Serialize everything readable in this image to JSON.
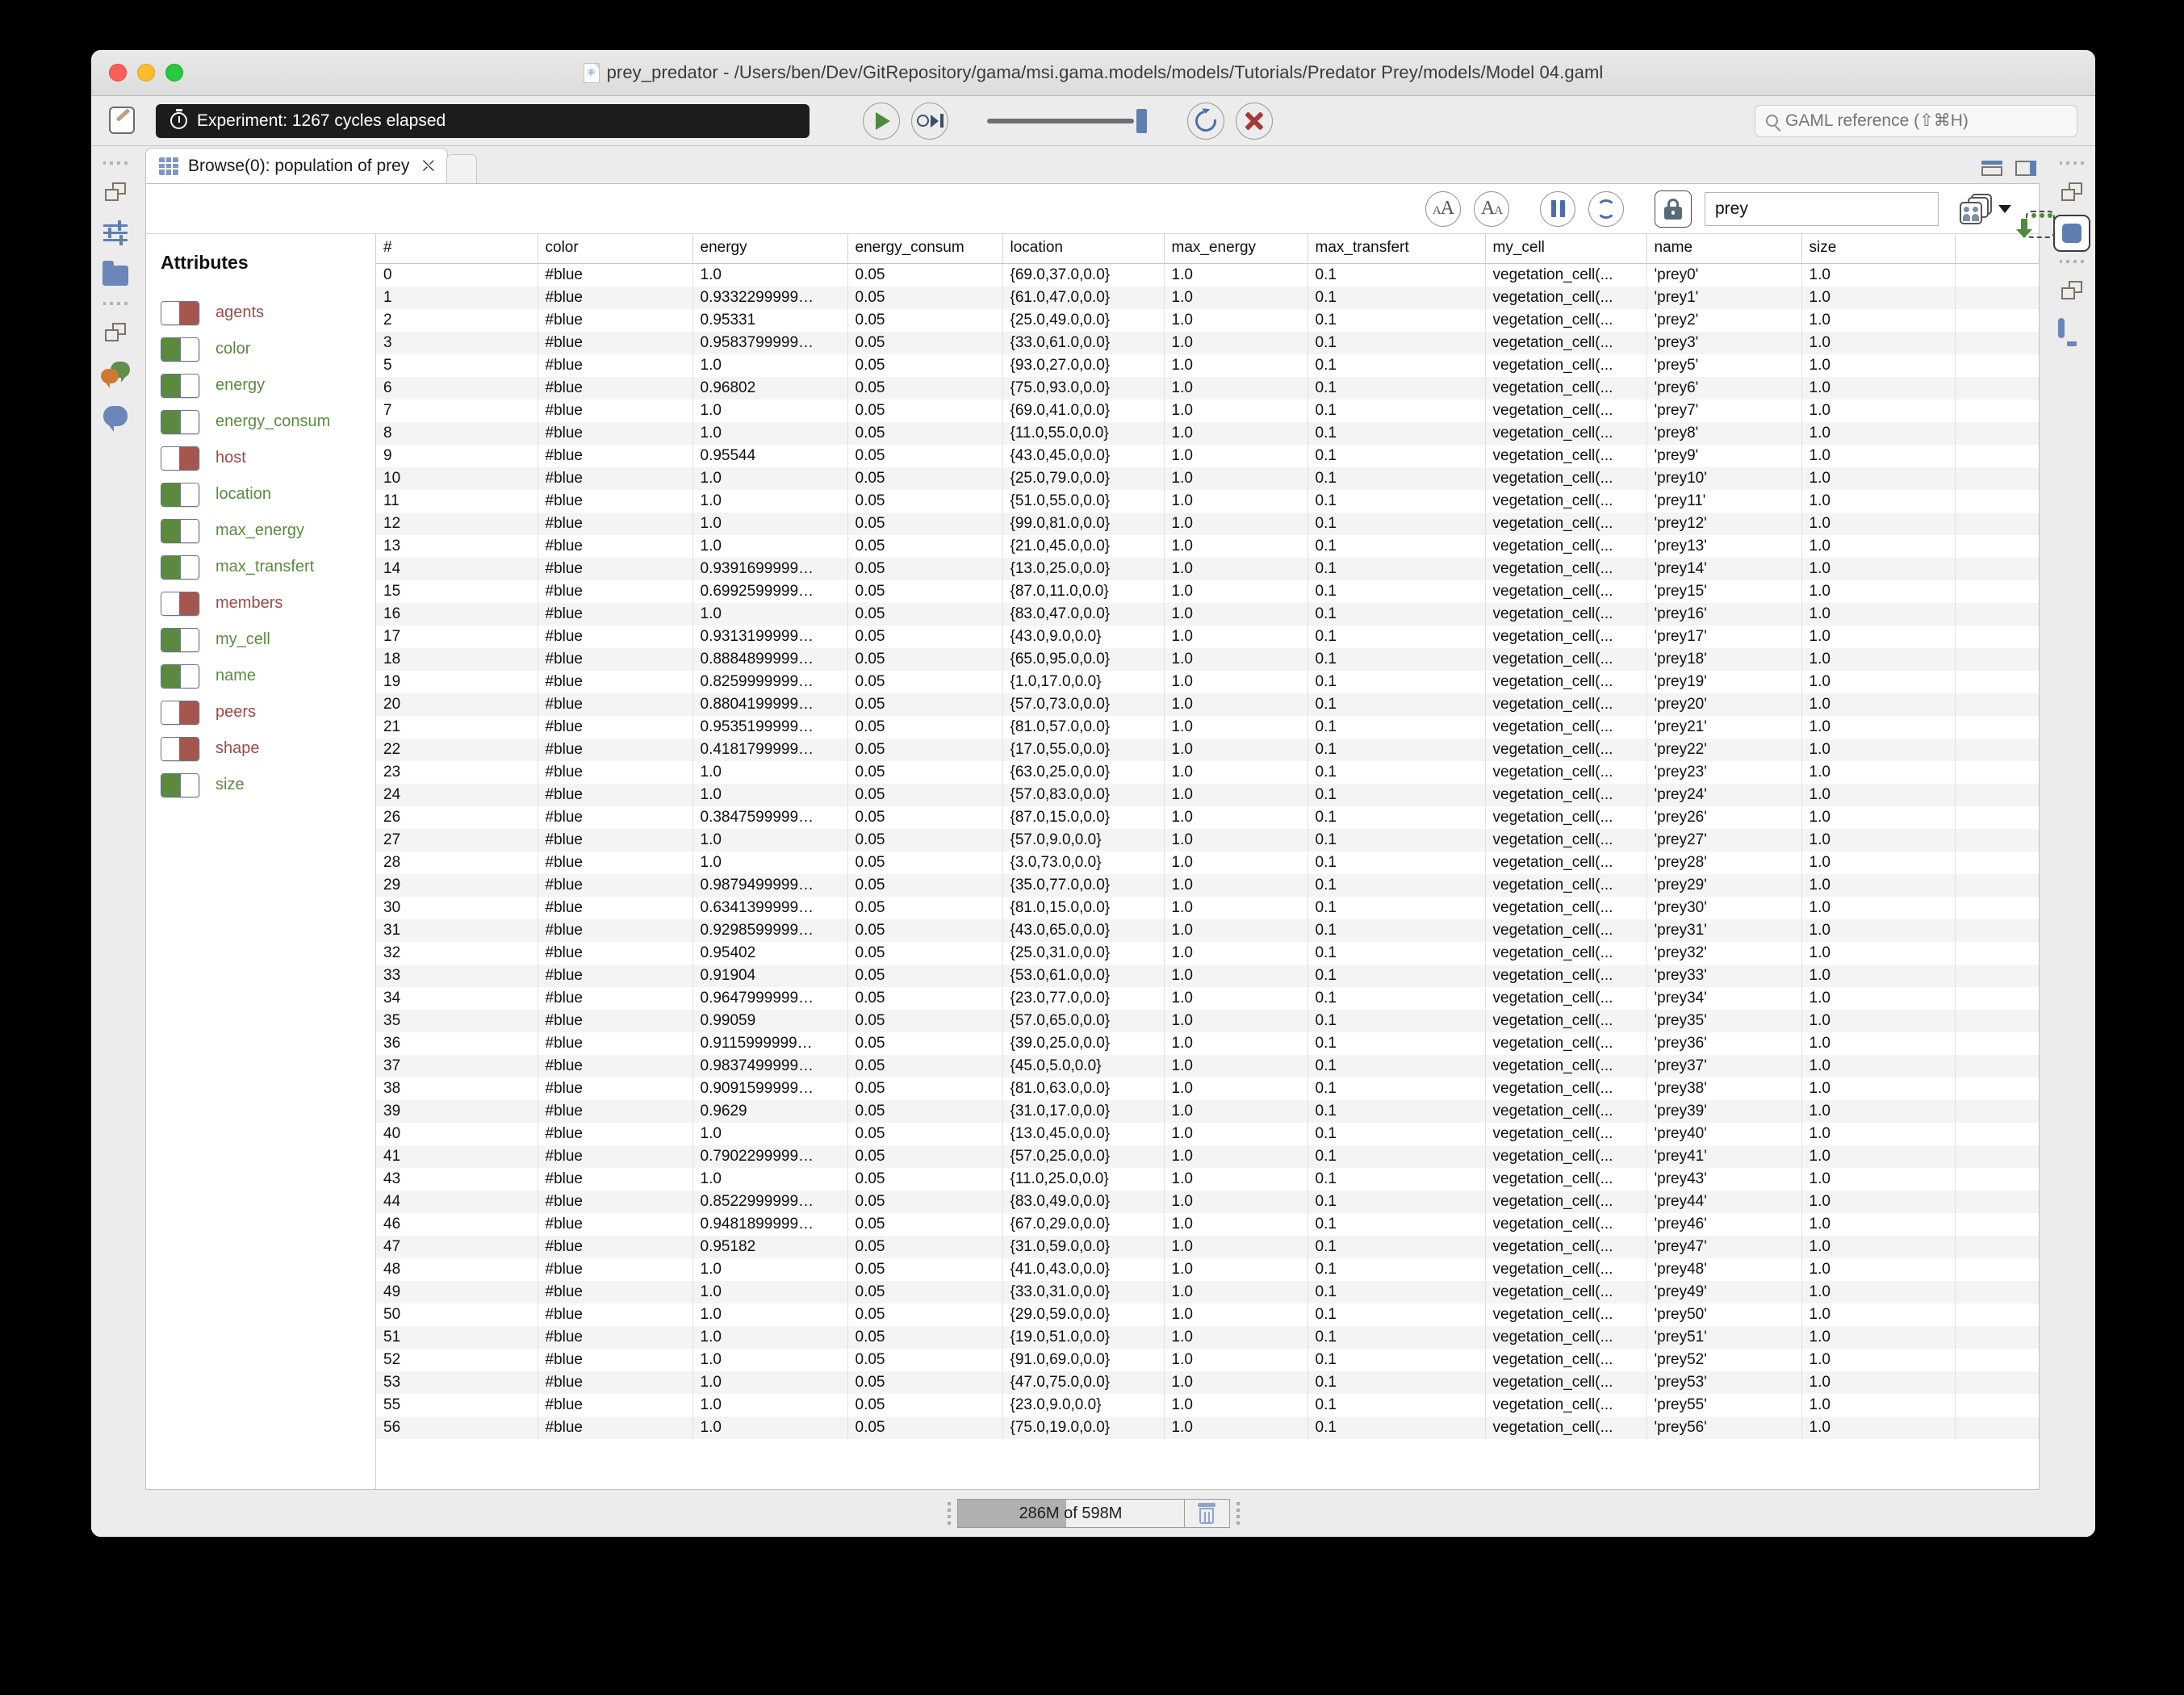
{
  "window": {
    "title": "prey_predator - /Users/ben/Dev/GitRepository/gama/msi.gama.models/models/Tutorials/Predator Prey/models/Model 04.gaml"
  },
  "toolbar": {
    "experiment_status": "Experiment: 1267 cycles elapsed",
    "play_label": "Run",
    "step_label": "Step",
    "reload_label": "Reload",
    "stop_label": "Close",
    "gaml_search_placeholder": "GAML reference (⇧⌘H)"
  },
  "tab": {
    "label": "Browse(0): population of prey"
  },
  "panel_toolbar": {
    "font_increase_label": "AA",
    "font_decrease_label": "AA",
    "pause_label": "Pause",
    "refresh_label": "Refresh",
    "lock_label": "Lock",
    "filter_value": "prey",
    "filter_placeholder": "",
    "agents_label": "Agents",
    "export_label": "Export"
  },
  "attributes": {
    "title": "Attributes",
    "items": [
      {
        "label": "agents",
        "enabled": false
      },
      {
        "label": "color",
        "enabled": true
      },
      {
        "label": "energy",
        "enabled": true
      },
      {
        "label": "energy_consum",
        "enabled": true
      },
      {
        "label": "host",
        "enabled": false
      },
      {
        "label": "location",
        "enabled": true
      },
      {
        "label": "max_energy",
        "enabled": true
      },
      {
        "label": "max_transfert",
        "enabled": true
      },
      {
        "label": "members",
        "enabled": false
      },
      {
        "label": "my_cell",
        "enabled": true
      },
      {
        "label": "name",
        "enabled": true
      },
      {
        "label": "peers",
        "enabled": false
      },
      {
        "label": "shape",
        "enabled": false
      },
      {
        "label": "size",
        "enabled": true
      }
    ]
  },
  "table": {
    "columns": [
      "#",
      "color",
      "energy",
      "energy_consum",
      "location",
      "max_energy",
      "max_transfert",
      "my_cell",
      "name",
      "size"
    ],
    "rows": [
      [
        "0",
        "#blue",
        "1.0",
        "0.05",
        "{69.0,37.0,0.0}",
        "1.0",
        "0.1",
        "vegetation_cell(...",
        "'prey0'",
        "1.0"
      ],
      [
        "1",
        "#blue",
        "0.9332299999…",
        "0.05",
        "{61.0,47.0,0.0}",
        "1.0",
        "0.1",
        "vegetation_cell(...",
        "'prey1'",
        "1.0"
      ],
      [
        "2",
        "#blue",
        "0.95331",
        "0.05",
        "{25.0,49.0,0.0}",
        "1.0",
        "0.1",
        "vegetation_cell(...",
        "'prey2'",
        "1.0"
      ],
      [
        "3",
        "#blue",
        "0.9583799999…",
        "0.05",
        "{33.0,61.0,0.0}",
        "1.0",
        "0.1",
        "vegetation_cell(...",
        "'prey3'",
        "1.0"
      ],
      [
        "5",
        "#blue",
        "1.0",
        "0.05",
        "{93.0,27.0,0.0}",
        "1.0",
        "0.1",
        "vegetation_cell(...",
        "'prey5'",
        "1.0"
      ],
      [
        "6",
        "#blue",
        "0.96802",
        "0.05",
        "{75.0,93.0,0.0}",
        "1.0",
        "0.1",
        "vegetation_cell(...",
        "'prey6'",
        "1.0"
      ],
      [
        "7",
        "#blue",
        "1.0",
        "0.05",
        "{69.0,41.0,0.0}",
        "1.0",
        "0.1",
        "vegetation_cell(...",
        "'prey7'",
        "1.0"
      ],
      [
        "8",
        "#blue",
        "1.0",
        "0.05",
        "{11.0,55.0,0.0}",
        "1.0",
        "0.1",
        "vegetation_cell(...",
        "'prey8'",
        "1.0"
      ],
      [
        "9",
        "#blue",
        "0.95544",
        "0.05",
        "{43.0,45.0,0.0}",
        "1.0",
        "0.1",
        "vegetation_cell(...",
        "'prey9'",
        "1.0"
      ],
      [
        "10",
        "#blue",
        "1.0",
        "0.05",
        "{25.0,79.0,0.0}",
        "1.0",
        "0.1",
        "vegetation_cell(...",
        "'prey10'",
        "1.0"
      ],
      [
        "11",
        "#blue",
        "1.0",
        "0.05",
        "{51.0,55.0,0.0}",
        "1.0",
        "0.1",
        "vegetation_cell(...",
        "'prey11'",
        "1.0"
      ],
      [
        "12",
        "#blue",
        "1.0",
        "0.05",
        "{99.0,81.0,0.0}",
        "1.0",
        "0.1",
        "vegetation_cell(...",
        "'prey12'",
        "1.0"
      ],
      [
        "13",
        "#blue",
        "1.0",
        "0.05",
        "{21.0,45.0,0.0}",
        "1.0",
        "0.1",
        "vegetation_cell(...",
        "'prey13'",
        "1.0"
      ],
      [
        "14",
        "#blue",
        "0.9391699999…",
        "0.05",
        "{13.0,25.0,0.0}",
        "1.0",
        "0.1",
        "vegetation_cell(...",
        "'prey14'",
        "1.0"
      ],
      [
        "15",
        "#blue",
        "0.6992599999…",
        "0.05",
        "{87.0,11.0,0.0}",
        "1.0",
        "0.1",
        "vegetation_cell(...",
        "'prey15'",
        "1.0"
      ],
      [
        "16",
        "#blue",
        "1.0",
        "0.05",
        "{83.0,47.0,0.0}",
        "1.0",
        "0.1",
        "vegetation_cell(...",
        "'prey16'",
        "1.0"
      ],
      [
        "17",
        "#blue",
        "0.9313199999…",
        "0.05",
        "{43.0,9.0,0.0}",
        "1.0",
        "0.1",
        "vegetation_cell(...",
        "'prey17'",
        "1.0"
      ],
      [
        "18",
        "#blue",
        "0.8884899999…",
        "0.05",
        "{65.0,95.0,0.0}",
        "1.0",
        "0.1",
        "vegetation_cell(...",
        "'prey18'",
        "1.0"
      ],
      [
        "19",
        "#blue",
        "0.8259999999…",
        "0.05",
        "{1.0,17.0,0.0}",
        "1.0",
        "0.1",
        "vegetation_cell(...",
        "'prey19'",
        "1.0"
      ],
      [
        "20",
        "#blue",
        "0.8804199999…",
        "0.05",
        "{57.0,73.0,0.0}",
        "1.0",
        "0.1",
        "vegetation_cell(...",
        "'prey20'",
        "1.0"
      ],
      [
        "21",
        "#blue",
        "0.9535199999…",
        "0.05",
        "{81.0,57.0,0.0}",
        "1.0",
        "0.1",
        "vegetation_cell(...",
        "'prey21'",
        "1.0"
      ],
      [
        "22",
        "#blue",
        "0.4181799999…",
        "0.05",
        "{17.0,55.0,0.0}",
        "1.0",
        "0.1",
        "vegetation_cell(...",
        "'prey22'",
        "1.0"
      ],
      [
        "23",
        "#blue",
        "1.0",
        "0.05",
        "{63.0,25.0,0.0}",
        "1.0",
        "0.1",
        "vegetation_cell(...",
        "'prey23'",
        "1.0"
      ],
      [
        "24",
        "#blue",
        "1.0",
        "0.05",
        "{57.0,83.0,0.0}",
        "1.0",
        "0.1",
        "vegetation_cell(...",
        "'prey24'",
        "1.0"
      ],
      [
        "26",
        "#blue",
        "0.3847599999…",
        "0.05",
        "{87.0,15.0,0.0}",
        "1.0",
        "0.1",
        "vegetation_cell(...",
        "'prey26'",
        "1.0"
      ],
      [
        "27",
        "#blue",
        "1.0",
        "0.05",
        "{57.0,9.0,0.0}",
        "1.0",
        "0.1",
        "vegetation_cell(...",
        "'prey27'",
        "1.0"
      ],
      [
        "28",
        "#blue",
        "1.0",
        "0.05",
        "{3.0,73.0,0.0}",
        "1.0",
        "0.1",
        "vegetation_cell(...",
        "'prey28'",
        "1.0"
      ],
      [
        "29",
        "#blue",
        "0.9879499999…",
        "0.05",
        "{35.0,77.0,0.0}",
        "1.0",
        "0.1",
        "vegetation_cell(...",
        "'prey29'",
        "1.0"
      ],
      [
        "30",
        "#blue",
        "0.6341399999…",
        "0.05",
        "{81.0,15.0,0.0}",
        "1.0",
        "0.1",
        "vegetation_cell(...",
        "'prey30'",
        "1.0"
      ],
      [
        "31",
        "#blue",
        "0.9298599999…",
        "0.05",
        "{43.0,65.0,0.0}",
        "1.0",
        "0.1",
        "vegetation_cell(...",
        "'prey31'",
        "1.0"
      ],
      [
        "32",
        "#blue",
        "0.95402",
        "0.05",
        "{25.0,31.0,0.0}",
        "1.0",
        "0.1",
        "vegetation_cell(...",
        "'prey32'",
        "1.0"
      ],
      [
        "33",
        "#blue",
        "0.91904",
        "0.05",
        "{53.0,61.0,0.0}",
        "1.0",
        "0.1",
        "vegetation_cell(...",
        "'prey33'",
        "1.0"
      ],
      [
        "34",
        "#blue",
        "0.9647999999…",
        "0.05",
        "{23.0,77.0,0.0}",
        "1.0",
        "0.1",
        "vegetation_cell(...",
        "'prey34'",
        "1.0"
      ],
      [
        "35",
        "#blue",
        "0.99059",
        "0.05",
        "{57.0,65.0,0.0}",
        "1.0",
        "0.1",
        "vegetation_cell(...",
        "'prey35'",
        "1.0"
      ],
      [
        "36",
        "#blue",
        "0.9115999999…",
        "0.05",
        "{39.0,25.0,0.0}",
        "1.0",
        "0.1",
        "vegetation_cell(...",
        "'prey36'",
        "1.0"
      ],
      [
        "37",
        "#blue",
        "0.9837499999…",
        "0.05",
        "{45.0,5.0,0.0}",
        "1.0",
        "0.1",
        "vegetation_cell(...",
        "'prey37'",
        "1.0"
      ],
      [
        "38",
        "#blue",
        "0.9091599999…",
        "0.05",
        "{81.0,63.0,0.0}",
        "1.0",
        "0.1",
        "vegetation_cell(...",
        "'prey38'",
        "1.0"
      ],
      [
        "39",
        "#blue",
        "0.9629",
        "0.05",
        "{31.0,17.0,0.0}",
        "1.0",
        "0.1",
        "vegetation_cell(...",
        "'prey39'",
        "1.0"
      ],
      [
        "40",
        "#blue",
        "1.0",
        "0.05",
        "{13.0,45.0,0.0}",
        "1.0",
        "0.1",
        "vegetation_cell(...",
        "'prey40'",
        "1.0"
      ],
      [
        "41",
        "#blue",
        "0.7902299999…",
        "0.05",
        "{57.0,25.0,0.0}",
        "1.0",
        "0.1",
        "vegetation_cell(...",
        "'prey41'",
        "1.0"
      ],
      [
        "43",
        "#blue",
        "1.0",
        "0.05",
        "{11.0,25.0,0.0}",
        "1.0",
        "0.1",
        "vegetation_cell(...",
        "'prey43'",
        "1.0"
      ],
      [
        "44",
        "#blue",
        "0.8522999999…",
        "0.05",
        "{83.0,49.0,0.0}",
        "1.0",
        "0.1",
        "vegetation_cell(...",
        "'prey44'",
        "1.0"
      ],
      [
        "46",
        "#blue",
        "0.9481899999…",
        "0.05",
        "{67.0,29.0,0.0}",
        "1.0",
        "0.1",
        "vegetation_cell(...",
        "'prey46'",
        "1.0"
      ],
      [
        "47",
        "#blue",
        "0.95182",
        "0.05",
        "{31.0,59.0,0.0}",
        "1.0",
        "0.1",
        "vegetation_cell(...",
        "'prey47'",
        "1.0"
      ],
      [
        "48",
        "#blue",
        "1.0",
        "0.05",
        "{41.0,43.0,0.0}",
        "1.0",
        "0.1",
        "vegetation_cell(...",
        "'prey48'",
        "1.0"
      ],
      [
        "49",
        "#blue",
        "1.0",
        "0.05",
        "{33.0,31.0,0.0}",
        "1.0",
        "0.1",
        "vegetation_cell(...",
        "'prey49'",
        "1.0"
      ],
      [
        "50",
        "#blue",
        "1.0",
        "0.05",
        "{29.0,59.0,0.0}",
        "1.0",
        "0.1",
        "vegetation_cell(...",
        "'prey50'",
        "1.0"
      ],
      [
        "51",
        "#blue",
        "1.0",
        "0.05",
        "{19.0,51.0,0.0}",
        "1.0",
        "0.1",
        "vegetation_cell(...",
        "'prey51'",
        "1.0"
      ],
      [
        "52",
        "#blue",
        "1.0",
        "0.05",
        "{91.0,69.0,0.0}",
        "1.0",
        "0.1",
        "vegetation_cell(...",
        "'prey52'",
        "1.0"
      ],
      [
        "53",
        "#blue",
        "1.0",
        "0.05",
        "{47.0,75.0,0.0}",
        "1.0",
        "0.1",
        "vegetation_cell(...",
        "'prey53'",
        "1.0"
      ],
      [
        "55",
        "#blue",
        "1.0",
        "0.05",
        "{23.0,9.0,0.0}",
        "1.0",
        "0.1",
        "vegetation_cell(...",
        "'prey55'",
        "1.0"
      ],
      [
        "56",
        "#blue",
        "1.0",
        "0.05",
        "{75.0,19.0,0.0}",
        "1.0",
        "0.1",
        "vegetation_cell(...",
        "'prey56'",
        "1.0"
      ]
    ]
  },
  "statusbar": {
    "heap_label": "286M of 598M",
    "heap_percent": 48,
    "trash_label": "Run garbage collector"
  },
  "colors": {
    "enabled_green": "#5b8a3f",
    "disabled_red": "#a5564f",
    "accent_blue": "#5e7fb0",
    "play_green": "#4c8c3c"
  }
}
